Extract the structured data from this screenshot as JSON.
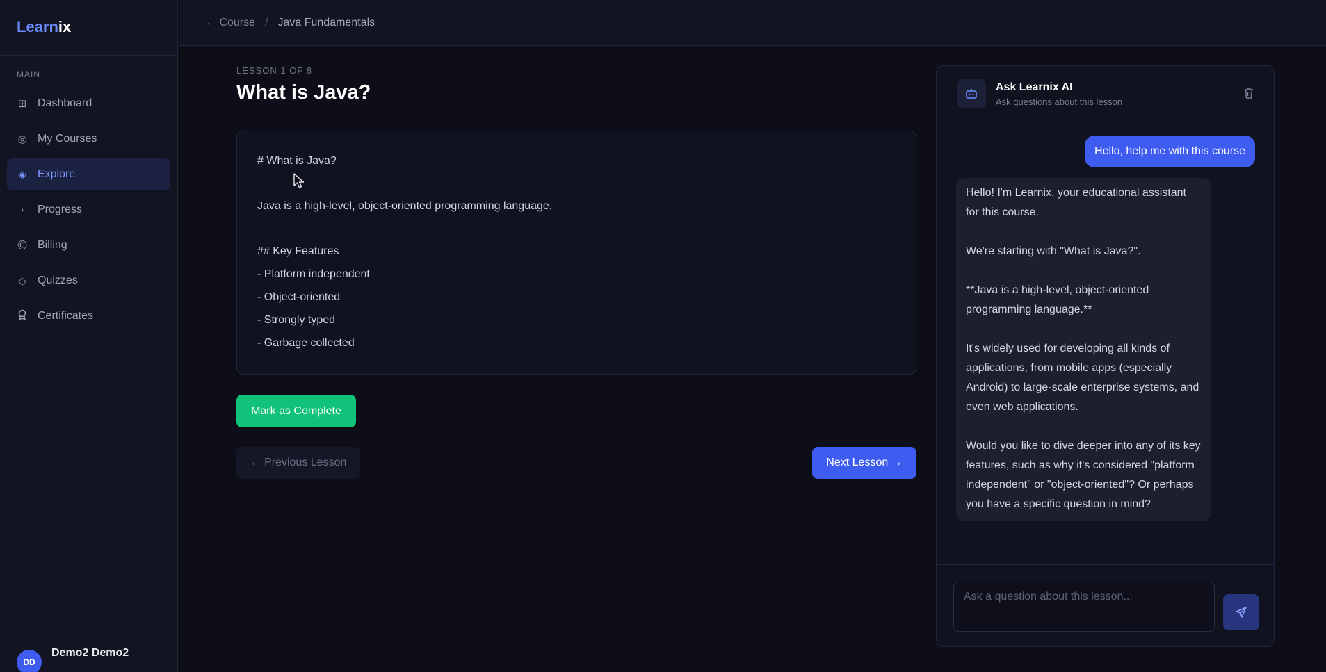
{
  "app": {
    "logo_part1": "Learn",
    "logo_part2": "ix"
  },
  "sidebar": {
    "section_label": "MAIN",
    "items": [
      {
        "label": "Dashboard",
        "icon": "grid-icon"
      },
      {
        "label": "My Courses",
        "icon": "target-icon"
      },
      {
        "label": "Explore",
        "icon": "diamond-icon",
        "active": true
      },
      {
        "label": "Progress",
        "icon": "pie-icon"
      },
      {
        "label": "Billing",
        "icon": "copyright-icon"
      },
      {
        "label": "Quizzes",
        "icon": "diamond-outline-icon"
      },
      {
        "label": "Certificates",
        "icon": "award-icon"
      }
    ],
    "user": {
      "initials": "DD",
      "name": "Demo2 Demo2"
    }
  },
  "breadcrumb": {
    "back_label": "← Course",
    "separator": "/",
    "current": "Java Fundamentals"
  },
  "lesson": {
    "meta": "LESSON 1 OF 8",
    "title": "What is Java?",
    "content": {
      "heading": "# What is Java?",
      "intro": "Java is a high-level, object-oriented programming language.",
      "features_heading": "## Key Features",
      "features": [
        "- Platform independent",
        "- Object-oriented",
        "- Strongly typed",
        "- Garbage collected"
      ]
    },
    "complete_label": "Mark as Complete",
    "prev_label": "← Previous Lesson",
    "next_label": "Next Lesson →"
  },
  "ai": {
    "title": "Ask Learnix AI",
    "subtitle": "Ask questions about this lesson",
    "user_message": "Hello, help me with this course",
    "assistant_message": [
      "Hello! I'm Learnix, your educational assistant for this course.",
      "We're starting with \"What is Java?\".",
      "**Java is a high-level, object-oriented programming language.**",
      "It's widely used for developing all kinds of applications, from mobile apps (especially Android) to large-scale enterprise systems, and even web applications.",
      "Would you like to dive deeper into any of its key features, such as why it's considered \"platform independent\" or \"object-oriented\"? Or perhaps you have a specific question in mind?"
    ],
    "input_placeholder": "Ask a question about this lesson...",
    "input_value": ""
  },
  "colors": {
    "accent": "#3f5cf0",
    "success": "#10c27a",
    "background": "#0d0e18",
    "sidebar": "#131422"
  }
}
